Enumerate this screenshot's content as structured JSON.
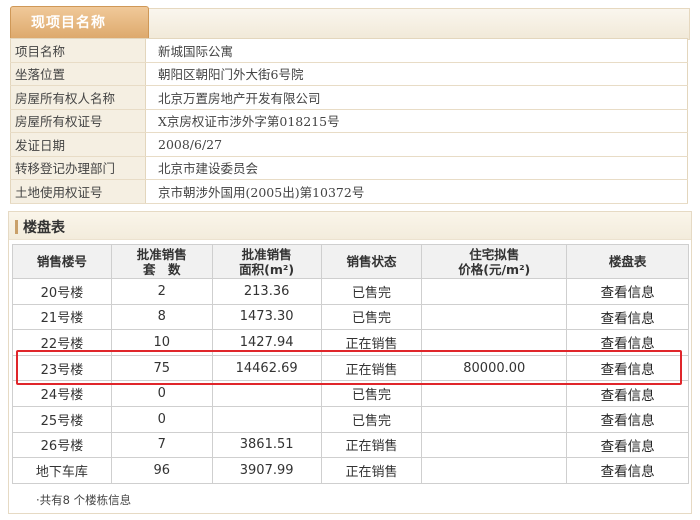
{
  "project": {
    "tab_title": "现项目名称",
    "rows": [
      {
        "label": "项目名称",
        "value": "新城国际公寓"
      },
      {
        "label": "坐落位置",
        "value": "朝阳区朝阳门外大街6号院"
      },
      {
        "label": "房屋所有权人名称",
        "value": "北京万置房地产开发有限公司"
      },
      {
        "label": "房屋所有权证号",
        "value": "X京房权证市涉外字第018215号"
      },
      {
        "label": "发证日期",
        "value": "2008/6/27"
      },
      {
        "label": "转移登记办理部门",
        "value": "北京市建设委员会"
      },
      {
        "label": "土地使用权证号",
        "value": "京市朝涉外国用(2005出)第10372号"
      }
    ]
  },
  "buildings": {
    "title": "楼盘表",
    "headers": {
      "col1": "销售楼号",
      "col2a": "批准销售",
      "col2b": "套　数",
      "col3a": "批准销售",
      "col3b": "面积(m²)",
      "col4": "销售状态",
      "col5a": "住宅拟售",
      "col5b": "价格(元/m²)",
      "col6": "楼盘表"
    },
    "rows": [
      {
        "name": "20号楼",
        "units": "2",
        "area": "213.36",
        "status": "已售完",
        "price": "",
        "link": "查看信息"
      },
      {
        "name": "21号楼",
        "units": "8",
        "area": "1473.30",
        "status": "已售完",
        "price": "",
        "link": "查看信息"
      },
      {
        "name": "22号楼",
        "units": "10",
        "area": "1427.94",
        "status": "正在销售",
        "price": "",
        "link": "查看信息"
      },
      {
        "name": "23号楼",
        "units": "75",
        "area": "14462.69",
        "status": "正在销售",
        "price": "80000.00",
        "link": "查看信息"
      },
      {
        "name": "24号楼",
        "units": "0",
        "area": "",
        "status": "已售完",
        "price": "",
        "link": "查看信息"
      },
      {
        "name": "25号楼",
        "units": "0",
        "area": "",
        "status": "已售完",
        "price": "",
        "link": "查看信息"
      },
      {
        "name": "26号楼",
        "units": "7",
        "area": "3861.51",
        "status": "正在销售",
        "price": "",
        "link": "查看信息"
      },
      {
        "name": "地下车库",
        "units": "96",
        "area": "3907.99",
        "status": "正在销售",
        "price": "",
        "link": "查看信息"
      }
    ],
    "footer": "·共有8 个楼栋信息",
    "highlight_color": "#e0262b"
  }
}
